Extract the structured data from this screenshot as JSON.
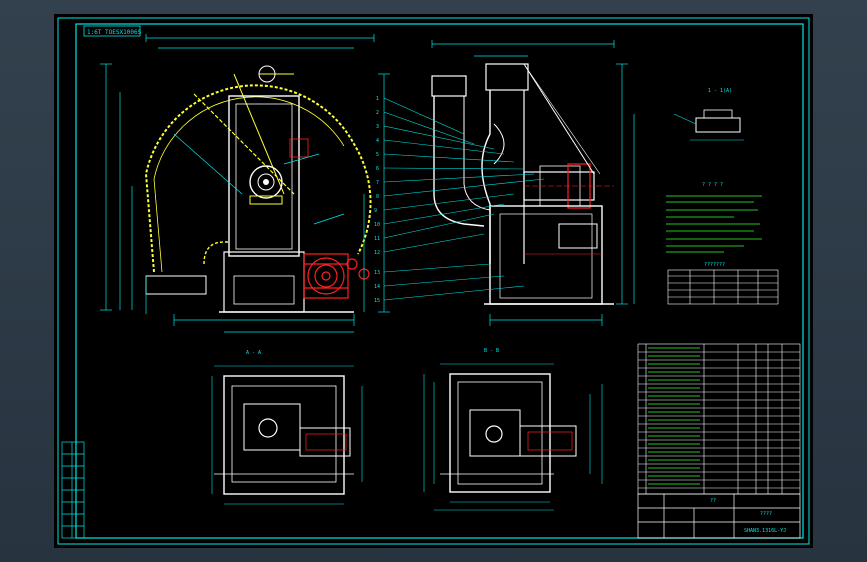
{
  "drawing": {
    "title_tag": "1:6T TOESX1006S",
    "section_a_label": "A - A",
    "section_b_label": "B - B",
    "section_top_label": "1 - 1(A)",
    "title_block_name": "????",
    "title_block_code": "SHAN3.1316L-YJ",
    "notes_heading": "? ? ? ?",
    "table_heading": "???????",
    "parts_footer": "??",
    "balloons": [
      "1",
      "2",
      "3",
      "4",
      "5",
      "6",
      "7",
      "8",
      "9",
      "10",
      "11",
      "12",
      "13",
      "14",
      "15",
      "16",
      "17",
      "18",
      "19"
    ]
  },
  "colors": {
    "background_frame": "#33414e",
    "sheet": "#000000",
    "cyan": "#00e6e6",
    "yellow": "#ffff33",
    "white": "#ffffff",
    "red": "#ff2020",
    "green": "#33ff33"
  }
}
